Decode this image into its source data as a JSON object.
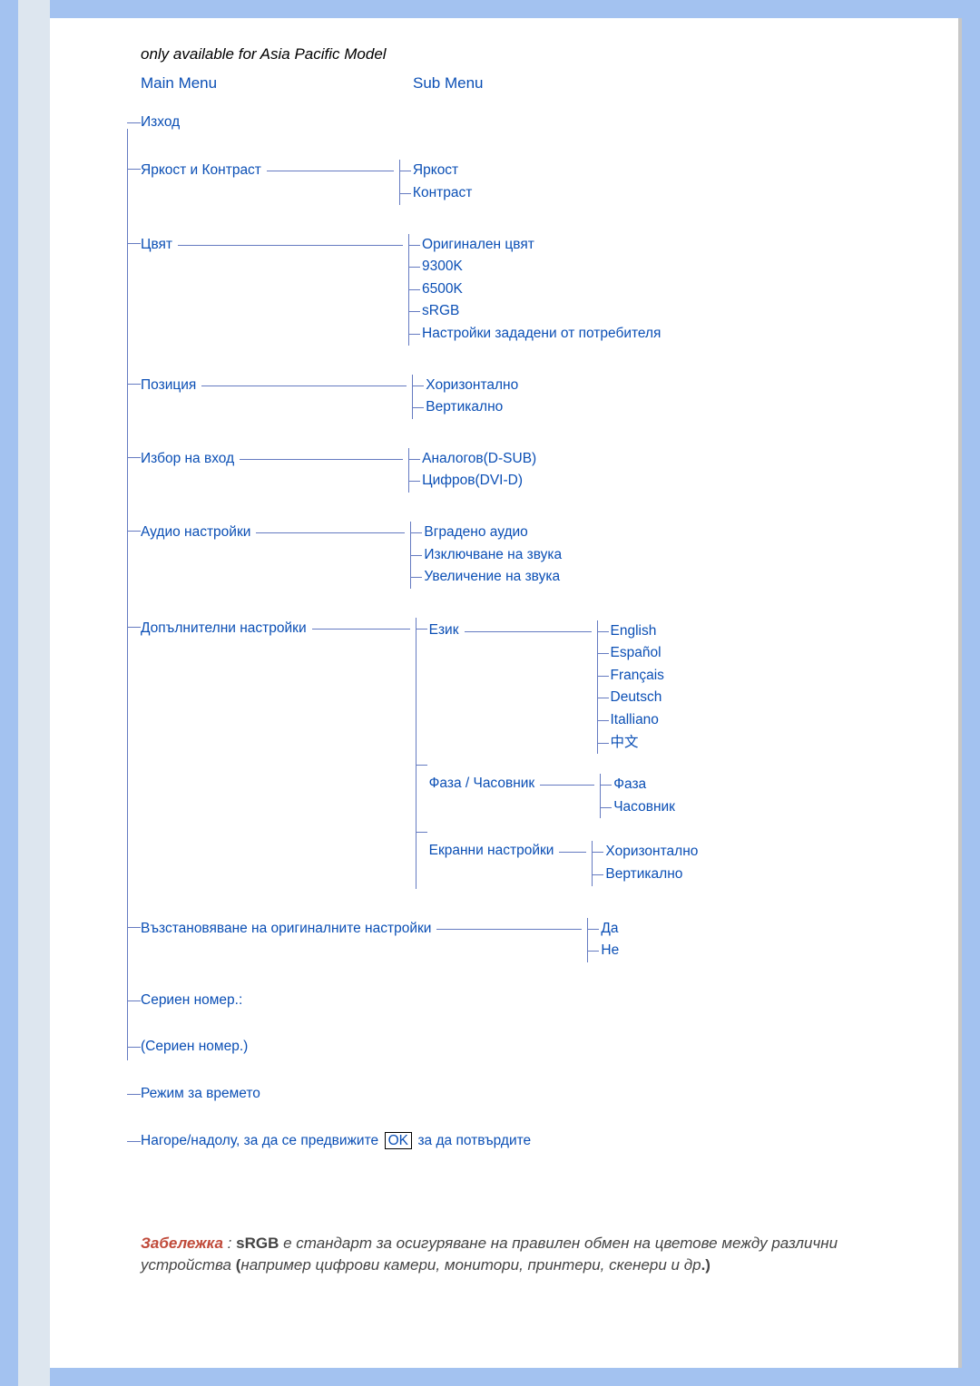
{
  "heading_note": "only available for Asia Pacific Model",
  "headers": {
    "main": "Main Menu",
    "sub": "Sub Menu"
  },
  "menu": {
    "exit": "Изход",
    "brightness": {
      "label": "Яркост и Контраст",
      "items": [
        "Яркост",
        "Контраст"
      ]
    },
    "color": {
      "label": "Цвят",
      "items": [
        "Оригинален цвят",
        "9300K",
        "6500K",
        "sRGB",
        "Настройки зададени от потребителя"
      ]
    },
    "position": {
      "label": "Позиция",
      "items": [
        "Хоризонтално",
        "Вертикално"
      ]
    },
    "input": {
      "label": "Избор на вход",
      "items": [
        "Аналогов(D-SUB)",
        "Цифров(DVI-D)"
      ]
    },
    "audio": {
      "label": "Аудио настройки",
      "items": [
        "Вградено аудио",
        "Изключване на звука",
        "Увеличение на звука"
      ]
    },
    "more": {
      "label": "Допълнителни настройки",
      "language": {
        "label": "Език",
        "items": [
          "English",
          "Español",
          "Français",
          "Deutsch",
          "Italliano",
          "中文"
        ]
      },
      "phase": {
        "label": "Фаза / Часовник",
        "items": [
          "Фаза",
          "Часовник"
        ]
      },
      "screen": {
        "label": "Екранни настройки",
        "items": [
          "Хоризонтално",
          "Вертикално"
        ]
      }
    },
    "reset": {
      "label": "Възстановяване на оригиналните настройки",
      "items": [
        "Да",
        "Не"
      ]
    },
    "serial_label": "Сериен номер.:",
    "serial_paren": "(Сериен номер.)",
    "time_mode": "Режим за времето",
    "nav_before": "Нагоре/надолу, за да се предвижите",
    "nav_ok": "OK",
    "nav_after": "за да потвърдите"
  },
  "footnote": {
    "label": "Забележка",
    "srgb": "sRGB",
    "text_before": " е стандарт за осигуряване на правилен обмен на цветове между различни устройства ",
    "text_paren": "например цифрови камери, монитори, принтери, скенери и др"
  }
}
